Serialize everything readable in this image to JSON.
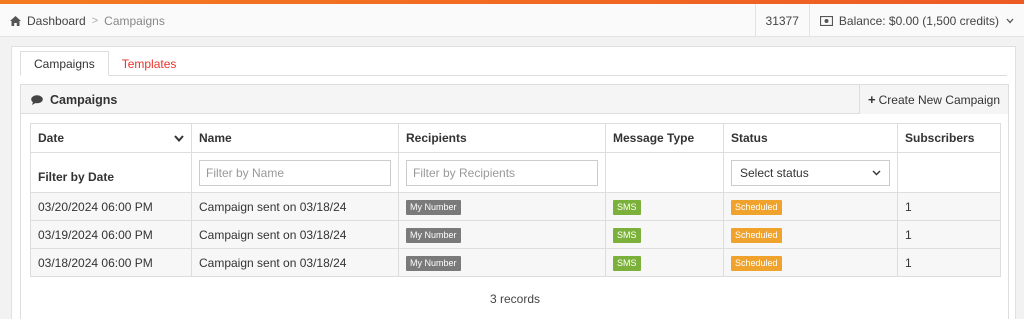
{
  "colors": {
    "accent": "#ee5a24",
    "link_red": "#e8332a",
    "sms_green": "#7bb13a",
    "scheduled_orange": "#f0a32c",
    "number_gray": "#7a7a7a"
  },
  "header": {
    "breadcrumb": {
      "home_icon": "home-icon",
      "home_label": "Dashboard",
      "current_label": "Campaigns"
    },
    "account_id": "31377",
    "balance_icon": "money-icon",
    "balance_label": "Balance: $0.00 (1,500 credits)"
  },
  "tabs": [
    {
      "label": "Campaigns",
      "active": true
    },
    {
      "label": "Templates",
      "active": false
    }
  ],
  "panel": {
    "title": "Campaigns",
    "title_icon": "comment-icon",
    "create_label": "Create New Campaign",
    "create_icon": "plus-icon"
  },
  "table": {
    "columns": [
      "Date",
      "Name",
      "Recipients",
      "Message Type",
      "Status",
      "Subscribers"
    ],
    "filters": {
      "date_label": "Filter by Date",
      "name_placeholder": "Filter by Name",
      "recipients_placeholder": "Filter by Recipients",
      "status_selected": "Select status"
    },
    "rows": [
      {
        "date": "03/20/2024 06:00 PM",
        "name": "Campaign sent on 03/18/24",
        "recipients": "My Number",
        "message_type": "SMS",
        "status": "Scheduled",
        "subscribers": "1"
      },
      {
        "date": "03/19/2024 06:00 PM",
        "name": "Campaign sent on 03/18/24",
        "recipients": "My Number",
        "message_type": "SMS",
        "status": "Scheduled",
        "subscribers": "1"
      },
      {
        "date": "03/18/2024 06:00 PM",
        "name": "Campaign sent on 03/18/24",
        "recipients": "My Number",
        "message_type": "SMS",
        "status": "Scheduled",
        "subscribers": "1"
      }
    ],
    "record_count": "3 records"
  }
}
